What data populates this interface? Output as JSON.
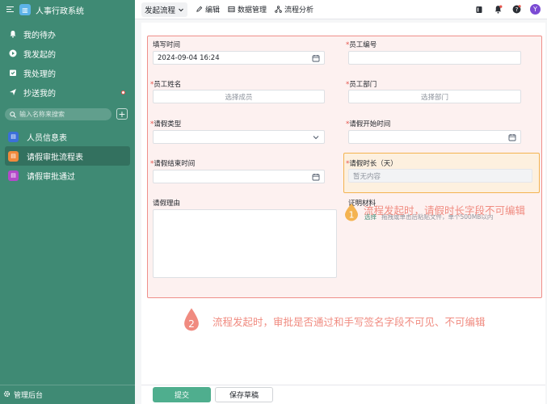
{
  "app": {
    "title": "人事行政系统",
    "logo_glyph": "▥"
  },
  "sidebar": {
    "nav": [
      {
        "label": "我的待办",
        "icon": "bell-icon"
      },
      {
        "label": "我发起的",
        "icon": "send-icon"
      },
      {
        "label": "我处理的",
        "icon": "check-box-icon"
      },
      {
        "label": "抄送我的",
        "icon": "cc-icon"
      }
    ],
    "search_placeholder": "输入名称来搜索",
    "add_glyph": "+",
    "forms": [
      {
        "label": "人员信息表",
        "icon_color": "#3b6fd9"
      },
      {
        "label": "请假审批流程表",
        "icon_color": "#f08a3c"
      },
      {
        "label": "请假审批通过",
        "icon_color": "#b349c9"
      }
    ],
    "footer": "管理后台"
  },
  "topbar": {
    "start_flow": "发起流程",
    "edit": "编辑",
    "data_manage": "数据管理",
    "flow_analysis": "流程分析",
    "avatar_letter": "Y"
  },
  "form": {
    "fill_time": {
      "label": "填写时间",
      "value": "2024-09-04 16:24"
    },
    "employee_no": {
      "label": "员工编号",
      "required_mark": "*"
    },
    "employee_name": {
      "label": "员工姓名",
      "required_mark": "*",
      "placeholder": "选择成员"
    },
    "department": {
      "label": "员工部门",
      "required_mark": "*",
      "placeholder": "选择部门"
    },
    "leave_type": {
      "label": "请假类型",
      "required_mark": "*"
    },
    "start_time": {
      "label": "请假开始时间",
      "required_mark": "*"
    },
    "end_time": {
      "label": "请假结束时间",
      "required_mark": "*"
    },
    "duration": {
      "label": "请假时长（天）",
      "required_mark": "*",
      "placeholder": "暂无内容"
    },
    "reason": {
      "label": "请假理由"
    },
    "attachment": {
      "label": "证明材料",
      "choose": "选择",
      "hint": "拖拽或单击后粘贴文件，单个500MB以内"
    }
  },
  "annotations": [
    {
      "number": "1",
      "text": "流程发起时，请假时长字段不可编辑"
    },
    {
      "number": "2",
      "text": "流程发起时，审批是否通过和手写签名字段不可见、不可编辑"
    }
  ],
  "buttons": {
    "submit": "提交",
    "save_draft": "保存草稿"
  },
  "colors": {
    "sidebar": "#3f8a74",
    "accent": "#4fae8e",
    "annotation": "#f08b80",
    "highlight_border": "#f4b350"
  }
}
